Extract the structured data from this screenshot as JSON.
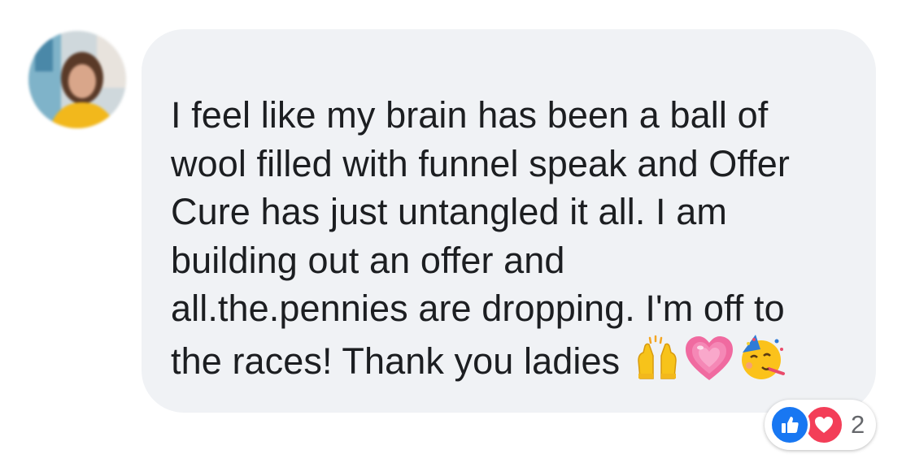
{
  "comment": {
    "line1": "I feel like my brain has been a ball of",
    "line2": "wool filled with funnel speak and Offer",
    "line3": "Cure has just untangled it all. I am",
    "line4": "building out an offer and",
    "line5": "all.the.pennies are dropping. I'm off to",
    "line6": "the races! Thank you ladies",
    "emojis": [
      "raising-hands-icon",
      "growing-heart-icon",
      "partying-face-icon"
    ]
  },
  "reactions": {
    "icons": [
      "like-icon",
      "love-icon"
    ],
    "count": "2"
  },
  "colors": {
    "bubble": "#f0f2f5",
    "text": "#1c1e21",
    "like": "#1877f2",
    "love": "#f33e58",
    "count": "#65676b"
  }
}
